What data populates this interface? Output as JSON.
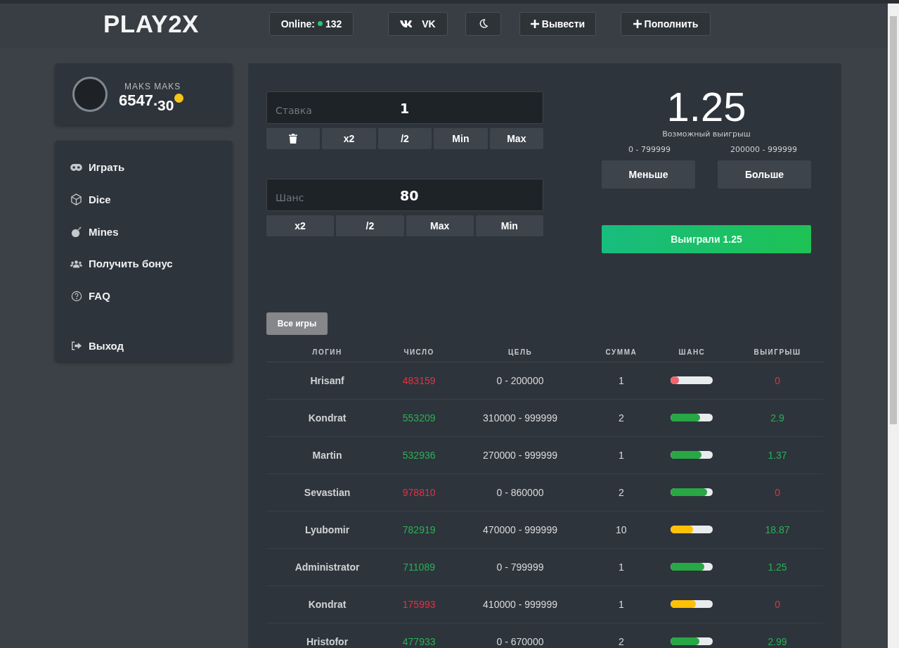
{
  "header": {
    "logo": "PLAY2X",
    "online": {
      "label": "Online:",
      "count": "132"
    },
    "buttons": [
      {
        "kind": "vk",
        "label": "VK"
      },
      {
        "kind": "theme"
      },
      {
        "kind": "withdraw",
        "label": "Вывести"
      },
      {
        "kind": "deposit",
        "label": "Пополнить"
      }
    ]
  },
  "profile": {
    "name": "MAKS MAKS",
    "balance": "6547.",
    "balance_decimals": "30"
  },
  "menu": [
    {
      "kind": "gamepad",
      "label": "Играть"
    },
    {
      "kind": "cube",
      "label": "Dice"
    },
    {
      "kind": "bomb",
      "label": "Mines"
    },
    {
      "kind": "users",
      "label": "Получить бонус"
    },
    {
      "kind": "faq",
      "label": "FAQ"
    },
    {
      "kind": "logout",
      "label": "Выход"
    }
  ],
  "bet": {
    "stake": {
      "label": "Ставка",
      "value": "1"
    },
    "stake_buttons": [
      {
        "kind": "clear"
      },
      {
        "kind": "text",
        "label": "x2"
      },
      {
        "kind": "text",
        "label": "/2"
      },
      {
        "kind": "text",
        "label": "Min"
      },
      {
        "kind": "text",
        "label": "Max"
      }
    ],
    "chance": {
      "label": "Шанс",
      "value": "80"
    },
    "chance_buttons": [
      {
        "kind": "text",
        "label": "x2"
      },
      {
        "kind": "text",
        "label": "/2"
      },
      {
        "kind": "text",
        "label": "Max"
      },
      {
        "kind": "text",
        "label": "Min"
      }
    ]
  },
  "outcome": {
    "multiplier": "1.25",
    "caption": "Возможный выигрыш",
    "low_range": "0 - 799999",
    "high_range": "200000 - 999999",
    "buttons": [
      "Меньше",
      "Больше"
    ],
    "result": "Выиграли 1.25"
  },
  "history": {
    "filter": "Все игры",
    "columns": [
      "ЛОГИН",
      "ЧИСЛО",
      "ЦЕЛЬ",
      "СУММА",
      "ШАНС",
      "ВЫИГРЫШ"
    ],
    "rows": [
      {
        "login": "Hrisanf",
        "number": "483159",
        "win": false,
        "target": "0 - 200000",
        "amount": "1",
        "chance": {
          "level": 0.2,
          "color": "#f0656b"
        },
        "payout": "0"
      },
      {
        "login": "Kondrat",
        "number": "553209",
        "win": true,
        "target": "310000 - 999999",
        "amount": "2",
        "chance": {
          "level": 0.69,
          "color": "#28a745"
        },
        "payout": "2.9"
      },
      {
        "login": "Martin",
        "number": "532936",
        "win": true,
        "target": "270000 - 999999",
        "amount": "1",
        "chance": {
          "level": 0.73,
          "color": "#28a745"
        },
        "payout": "1.37"
      },
      {
        "login": "Sevastian",
        "number": "978810",
        "win": false,
        "target": "0 - 860000",
        "amount": "2",
        "chance": {
          "level": 0.86,
          "color": "#28a745"
        },
        "payout": "0"
      },
      {
        "login": "Lyubomir",
        "number": "782919",
        "win": true,
        "target": "470000 - 999999",
        "amount": "10",
        "chance": {
          "level": 0.53,
          "color": "#ffc107"
        },
        "payout": "18.87"
      },
      {
        "login": "Administrator",
        "number": "711089",
        "win": true,
        "target": "0 - 799999",
        "amount": "1",
        "chance": {
          "level": 0.8,
          "color": "#28a745"
        },
        "payout": "1.25"
      },
      {
        "login": "Kondrat",
        "number": "175993",
        "win": false,
        "target": "410000 - 999999",
        "amount": "1",
        "chance": {
          "level": 0.59,
          "color": "#ffc107"
        },
        "payout": "0"
      },
      {
        "login": "Hristofor",
        "number": "477933",
        "win": true,
        "target": "0 - 670000",
        "amount": "2",
        "chance": {
          "level": 0.67,
          "color": "#28a745"
        },
        "payout": "2.99"
      }
    ]
  }
}
